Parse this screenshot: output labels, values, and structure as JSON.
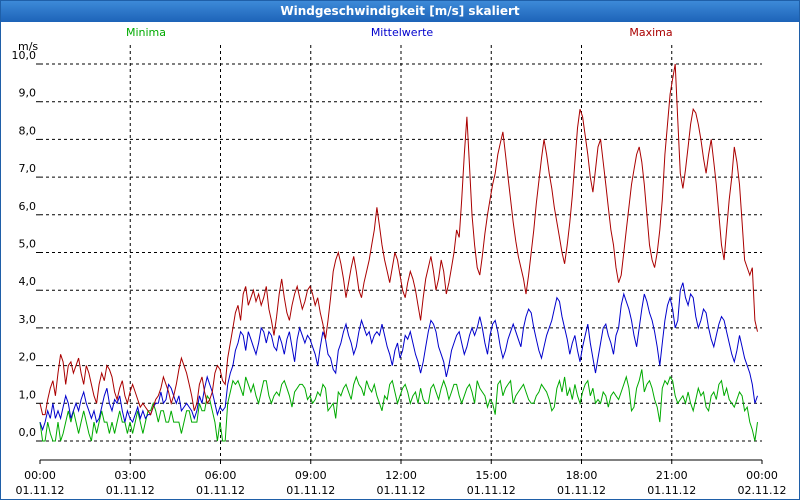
{
  "window": {
    "title": "Windgeschwindigkeit [m/s] skaliert"
  },
  "chart_data": {
    "type": "line",
    "title": "Windgeschwindigkeit [m/s] skaliert",
    "ylabel": "m/s",
    "xlabel": "",
    "ylim": [
      0,
      10
    ],
    "xlim": [
      0,
      24
    ],
    "grid": true,
    "legend_position": "top",
    "y_ticks": [
      "0,0",
      "1,0",
      "2,0",
      "3,0",
      "4,0",
      "5,0",
      "6,0",
      "7,0",
      "8,0",
      "9,0",
      "10,0"
    ],
    "x_ticks": [
      {
        "time": "00:00",
        "date": "01.11.12"
      },
      {
        "time": "03:00",
        "date": "01.11.12"
      },
      {
        "time": "06:00",
        "date": "01.11.12"
      },
      {
        "time": "09:00",
        "date": "01.11.12"
      },
      {
        "time": "12:00",
        "date": "01.11.12"
      },
      {
        "time": "15:00",
        "date": "01.11.12"
      },
      {
        "time": "18:00",
        "date": "01.11.12"
      },
      {
        "time": "21:00",
        "date": "01.11.12"
      },
      {
        "time": "00:00",
        "date": "02.11.12"
      }
    ],
    "series": [
      {
        "name": "Minima",
        "color": "#00aa00",
        "values": [
          0.5,
          0,
          0,
          0.5,
          0.2,
          0,
          0,
          0.5,
          0,
          0.2,
          0.5,
          0.8,
          0.5,
          0.8,
          0.5,
          0.2,
          0.5,
          0.8,
          0.5,
          0.2,
          0,
          0.5,
          0.2,
          0.5,
          0.8,
          0.5,
          0.5,
          0.2,
          0.5,
          0.2,
          0.5,
          0.8,
          0.5,
          0.5,
          0.2,
          0.5,
          0.2,
          0.5,
          0.8,
          0.5,
          0.2,
          0.5,
          0.8,
          0.8,
          1.0,
          0.8,
          0.5,
          0.8,
          0.8,
          0.5,
          0.5,
          0.8,
          0.5,
          0.5,
          0.5,
          0.2,
          0.5,
          0.8,
          0.8,
          0.5,
          0.5,
          0.5,
          1.0,
          0.8,
          0.8,
          1.2,
          1.1,
          0.8,
          0.5,
          0,
          0.5,
          0,
          0,
          1.0,
          1.3,
          1.6,
          1.5,
          1.6,
          1.4,
          1.2,
          1.7,
          1.5,
          1.3,
          1.5,
          1.2,
          1.0,
          1.3,
          1.6,
          1.6,
          1.2,
          1.0,
          1.2,
          1.3,
          1.2,
          1.5,
          1.6,
          1.4,
          1.2,
          0.9,
          1.3,
          1.4,
          1.5,
          1.5,
          1.4,
          1.1,
          1.2,
          1.0,
          1.1,
          1.3,
          1.2,
          1.5,
          1.4,
          0.8,
          0.9,
          1.0,
          0.6,
          1.3,
          1.2,
          1.4,
          1.5,
          1.3,
          1.1,
          1.5,
          1.7,
          1.5,
          1.4,
          1.2,
          1.6,
          1.4,
          1.3,
          1.5,
          1.2,
          1.0,
          0.8,
          1.2,
          1.1,
          1.5,
          1.6,
          1.3,
          1.0,
          1.2,
          1.4,
          1.5,
          1.3,
          1.0,
          1.2,
          1.3,
          1.0,
          1.4,
          1.1,
          1.0,
          1.0,
          1.4,
          1.5,
          1.3,
          1.1,
          1.4,
          1.6,
          1.4,
          1.1,
          1.3,
          1.5,
          1.5,
          1.2,
          1.0,
          1.2,
          1.4,
          1.5,
          1.3,
          1.0,
          1.6,
          1.4,
          1.3,
          1.2,
          0.9,
          1.1,
          1.0,
          0.7,
          1.5,
          1.6,
          1.2,
          1.4,
          1.5,
          1.6,
          1.0,
          1.2,
          1.3,
          1.4,
          1.5,
          1.3,
          1.1,
          1.0,
          1.0,
          1.2,
          1.3,
          1.5,
          1.4,
          1.3,
          1.1,
          0.8,
          0.9,
          1.4,
          1.6,
          1.3,
          1.7,
          1.2,
          1.4,
          1.1,
          1.5,
          1.2,
          1.0,
          1.3,
          1.5,
          1.6,
          1.2,
          1.4,
          1.0,
          1.1,
          1.0,
          1.3,
          1.2,
          0.9,
          1.2,
          1.3,
          1.2,
          1.1,
          1.3,
          1.5,
          1.7,
          1.4,
          0.8,
          0.9,
          1.4,
          1.6,
          1.9,
          1.3,
          1.5,
          1.6,
          1.4,
          1.1,
          0.9,
          0.5,
          1.4,
          1.6,
          1.5,
          1.7,
          1.6,
          1.2,
          1.0,
          1.1,
          1.2,
          1.0,
          1.3,
          1.0,
          0.8,
          1.1,
          1.4,
          1.2,
          1.3,
          0.9,
          0.8,
          1.2,
          1.3,
          1.1,
          1.5,
          1.6,
          1.2,
          1.4,
          1.1,
          1.0,
          0.9,
          1.1,
          1.3,
          1.2,
          0.8,
          0.9,
          0.5,
          0.3,
          0,
          0.5
        ]
      },
      {
        "name": "Mittelwerte",
        "color": "#0000cc",
        "values": [
          0.5,
          0.3,
          0.5,
          0.8,
          0.6,
          1.0,
          0.6,
          0.8,
          0.6,
          0.9,
          1.2,
          1.0,
          0.6,
          0.8,
          1.0,
          0.8,
          1.1,
          1.3,
          1.0,
          0.8,
          0.6,
          0.8,
          0.5,
          0.6,
          0.9,
          1.2,
          1.4,
          1.0,
          0.8,
          1.1,
          1.0,
          1.2,
          0.8,
          0.5,
          0.8,
          0.6,
          0.5,
          0.7,
          0.9,
          0.6,
          0.8,
          0.6,
          0.7,
          0.7,
          0.9,
          1.0,
          1.0,
          1.3,
          1.0,
          1.1,
          1.5,
          1.4,
          1.2,
          1.0,
          1.2,
          0.8,
          0.9,
          1.0,
          0.9,
          0.8,
          0.6,
          0.8,
          1.2,
          1.0,
          1.4,
          1.7,
          1.5,
          1.3,
          1.0,
          0.7,
          0.9,
          0.8,
          0.9,
          1.5,
          1.8,
          2.0,
          2.4,
          2.6,
          2.9,
          2.8,
          2.4,
          2.9,
          2.7,
          2.5,
          2.3,
          2.6,
          3.0,
          2.9,
          2.6,
          2.9,
          2.8,
          2.5,
          2.4,
          2.8,
          2.6,
          2.3,
          2.7,
          2.9,
          2.5,
          2.1,
          2.7,
          3.0,
          2.8,
          2.6,
          2.8,
          2.7,
          2.5,
          2.3,
          2.0,
          2.5,
          2.9,
          2.7,
          2.3,
          2.2,
          1.9,
          1.8,
          2.4,
          2.6,
          2.9,
          3.1,
          2.8,
          2.6,
          2.3,
          2.5,
          2.9,
          3.2,
          3.0,
          2.8,
          2.9,
          2.6,
          2.8,
          2.9,
          2.8,
          3.1,
          2.8,
          2.5,
          2.3,
          2.0,
          2.4,
          2.6,
          2.2,
          2.4,
          2.8,
          2.7,
          2.9,
          2.6,
          2.3,
          2.1,
          1.8,
          2.1,
          2.5,
          2.9,
          3.2,
          3.1,
          2.9,
          2.5,
          2.3,
          2.1,
          1.7,
          2.0,
          2.4,
          2.6,
          2.8,
          2.9,
          2.6,
          2.3,
          2.5,
          2.8,
          3.0,
          2.8,
          3.0,
          3.3,
          3.0,
          2.6,
          2.3,
          2.8,
          3.1,
          3.2,
          2.9,
          2.5,
          2.2,
          2.4,
          2.7,
          2.9,
          3.1,
          2.9,
          2.7,
          2.5,
          3.0,
          3.3,
          3.5,
          3.4,
          3.0,
          2.7,
          2.4,
          2.2,
          2.5,
          2.8,
          3.0,
          3.2,
          3.5,
          3.8,
          3.7,
          3.3,
          3.0,
          2.7,
          2.3,
          2.6,
          2.8,
          2.4,
          2.1,
          2.5,
          2.8,
          3.1,
          2.6,
          2.2,
          1.8,
          2.2,
          2.6,
          3.0,
          3.1,
          2.8,
          2.6,
          2.3,
          2.8,
          3.0,
          3.6,
          3.9,
          3.7,
          3.5,
          3.2,
          2.8,
          2.5,
          3.0,
          3.5,
          3.9,
          3.7,
          3.4,
          3.2,
          2.9,
          2.5,
          2.0,
          2.6,
          3.2,
          3.6,
          3.8,
          3.5,
          3.0,
          3.2,
          4.0,
          4.2,
          3.8,
          3.6,
          3.9,
          3.8,
          3.3,
          3.0,
          3.2,
          3.5,
          3.4,
          3.0,
          2.7,
          2.5,
          2.8,
          3.1,
          3.3,
          3.2,
          2.9,
          2.6,
          2.3,
          2.1,
          2.4,
          2.8,
          2.5,
          2.2,
          2.0,
          1.8,
          1.5,
          1.0,
          1.2
        ]
      },
      {
        "name": "Maxima",
        "color": "#aa0000",
        "values": [
          1.0,
          0.7,
          0.7,
          1.1,
          1.4,
          1.6,
          1.2,
          1.8,
          2.3,
          2.1,
          1.5,
          2.0,
          2.1,
          1.8,
          2.0,
          2.2,
          1.8,
          1.5,
          2.0,
          1.8,
          1.5,
          1.2,
          1.0,
          1.5,
          1.8,
          1.6,
          2.0,
          1.9,
          1.7,
          1.3,
          1.1,
          1.4,
          1.6,
          1.2,
          1.0,
          1.3,
          1.5,
          1.3,
          1.1,
          0.9,
          1.0,
          0.9,
          0.8,
          0.7,
          0.9,
          1.1,
          1.2,
          1.4,
          1.7,
          1.5,
          1.3,
          1.0,
          1.2,
          1.5,
          1.9,
          2.2,
          2.0,
          1.8,
          1.5,
          1.2,
          0.8,
          1.0,
          1.5,
          1.7,
          1.3,
          1.0,
          1.1,
          1.3,
          1.8,
          2.0,
          1.9,
          1.6,
          1.5,
          2.2,
          2.6,
          3.0,
          3.4,
          3.6,
          3.2,
          3.9,
          4.1,
          3.6,
          3.8,
          4.0,
          3.7,
          3.9,
          3.6,
          3.8,
          4.1,
          3.5,
          3.2,
          2.8,
          3.3,
          3.9,
          4.3,
          3.8,
          3.4,
          3.2,
          3.6,
          3.9,
          4.1,
          3.8,
          3.5,
          3.7,
          4.0,
          4.1,
          3.9,
          3.6,
          3.8,
          3.4,
          3.1,
          2.7,
          3.2,
          3.8,
          4.5,
          4.8,
          5.0,
          4.7,
          4.3,
          3.8,
          4.2,
          4.6,
          4.9,
          4.5,
          4.0,
          3.8,
          4.2,
          4.5,
          4.8,
          5.2,
          5.6,
          6.2,
          5.7,
          5.2,
          4.8,
          4.5,
          4.2,
          4.6,
          5.0,
          4.8,
          4.4,
          4.0,
          3.8,
          4.2,
          4.5,
          4.3,
          4.0,
          3.6,
          3.2,
          3.8,
          4.3,
          4.6,
          4.9,
          4.5,
          4.0,
          4.3,
          4.8,
          4.5,
          3.9,
          4.2,
          4.6,
          5.0,
          5.6,
          5.4,
          6.4,
          7.6,
          8.6,
          7.3,
          6.0,
          5.2,
          4.6,
          4.4,
          4.9,
          5.5,
          6.0,
          6.4,
          6.8,
          7.1,
          7.6,
          7.9,
          8.2,
          7.6,
          7.0,
          6.4,
          5.8,
          5.3,
          4.9,
          4.6,
          4.3,
          3.9,
          4.4,
          5.0,
          5.6,
          6.3,
          6.9,
          7.5,
          8.0,
          7.6,
          7.1,
          6.7,
          6.2,
          5.8,
          5.4,
          5.0,
          4.7,
          5.2,
          5.8,
          6.5,
          7.4,
          8.3,
          8.8,
          8.6,
          8.1,
          7.6,
          7.0,
          6.6,
          7.2,
          7.8,
          8.0,
          7.4,
          6.8,
          6.2,
          5.6,
          5.2,
          4.6,
          4.2,
          4.4,
          5.0,
          5.6,
          6.2,
          6.8,
          7.2,
          7.6,
          7.8,
          7.4,
          6.8,
          6.0,
          5.2,
          4.8,
          4.6,
          5.0,
          5.6,
          6.4,
          7.6,
          8.4,
          9.2,
          9.6,
          10.0,
          8.5,
          7.1,
          6.7,
          7.2,
          7.8,
          8.4,
          8.8,
          8.7,
          8.4,
          8.0,
          7.5,
          7.1,
          7.6,
          8.0,
          7.4,
          6.8,
          6.0,
          5.2,
          4.8,
          5.6,
          6.4,
          7.0,
          7.8,
          7.4,
          6.8,
          5.8,
          4.8,
          4.6,
          4.4,
          4.6,
          3.2,
          2.9
        ]
      }
    ]
  }
}
